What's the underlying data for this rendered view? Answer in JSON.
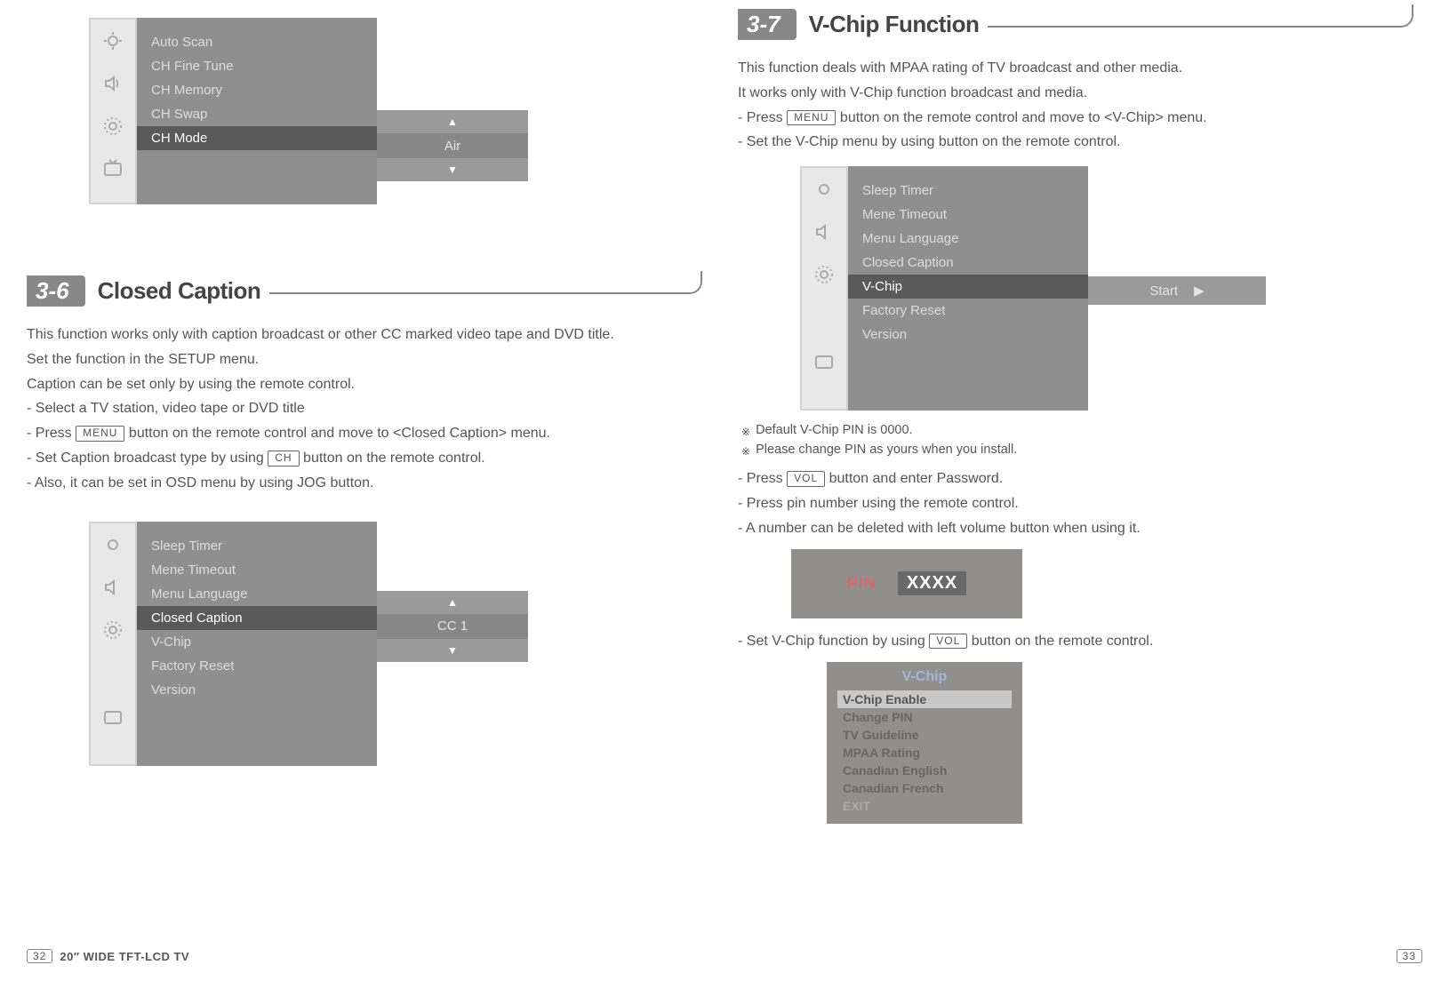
{
  "left": {
    "osd1": {
      "items": [
        "Auto Scan",
        "CH Fine Tune",
        "CH Memory",
        "CH Swap",
        "CH Mode"
      ],
      "selected_index": 4,
      "value": "Air"
    },
    "section": {
      "tag": "3-6",
      "title": "Closed Caption"
    },
    "body": {
      "p1": "This function works only with caption broadcast or other CC marked video tape and DVD title.",
      "p2": "Set the function in the SETUP menu.",
      "p3": "Caption can be set only by using the remote control.",
      "b1": "- Select a TV station, video tape or DVD title",
      "b2_pre": "- Press ",
      "b2_key": "MENU",
      "b2_post": " button on the remote control and move to <Closed Caption> menu.",
      "b3_pre": "- Set Caption broadcast type by using ",
      "b3_key": "CH",
      "b3_post": " button on the remote control.",
      "b4": "- Also, it can be set in OSD menu by using JOG button."
    },
    "osd2": {
      "items": [
        "Sleep Timer",
        "Mene Timeout",
        "Menu Language",
        "Closed Caption",
        "V-Chip",
        "Factory Reset",
        "Version"
      ],
      "selected_index": 3,
      "value": "CC 1"
    }
  },
  "right": {
    "section": {
      "tag": "3-7",
      "title": "V-Chip Function"
    },
    "body1": {
      "p1": "This function deals with MPAA rating of TV broadcast and other media.",
      "p2": "It works only with V-Chip function broadcast and media.",
      "b1_pre": "- Press ",
      "b1_key": "MENU",
      "b1_post": " button on the remote control and move to <V-Chip> menu.",
      "b2": "- Set the V-Chip menu by using button on the remote control."
    },
    "osd3": {
      "items": [
        "Sleep Timer",
        "Mene Timeout",
        "Menu Language",
        "Closed Caption",
        "V-Chip",
        "Factory Reset",
        "Version"
      ],
      "selected_index": 4,
      "value": "Start"
    },
    "notes": {
      "n1": "Default V-Chip PIN is 0000.",
      "n2": "Please change PIN as yours when you install."
    },
    "body2": {
      "b1_pre": "- Press ",
      "b1_key": "VOL",
      "b1_post": " button and enter Password.",
      "b2": "- Press pin number using the remote control.",
      "b3": "- A number can be deleted with left volume button when using it."
    },
    "pin": {
      "label": "PIN",
      "value": "XXXX"
    },
    "body3": {
      "b1_pre": "- Set V-Chip function by using ",
      "b1_key": "VOL",
      "b1_post": " button on the remote control."
    },
    "vchip_menu": {
      "title": "V-Chip",
      "items": [
        "V-Chip Enable",
        "Change PIN",
        "TV Guideline",
        "MPAA Rating",
        "Canadian English",
        "Canadian French",
        "EXIT"
      ],
      "selected_index": 0
    }
  },
  "footer": {
    "left_page": "32",
    "left_title": "20″ WIDE TFT-LCD TV",
    "right_page": "33"
  }
}
